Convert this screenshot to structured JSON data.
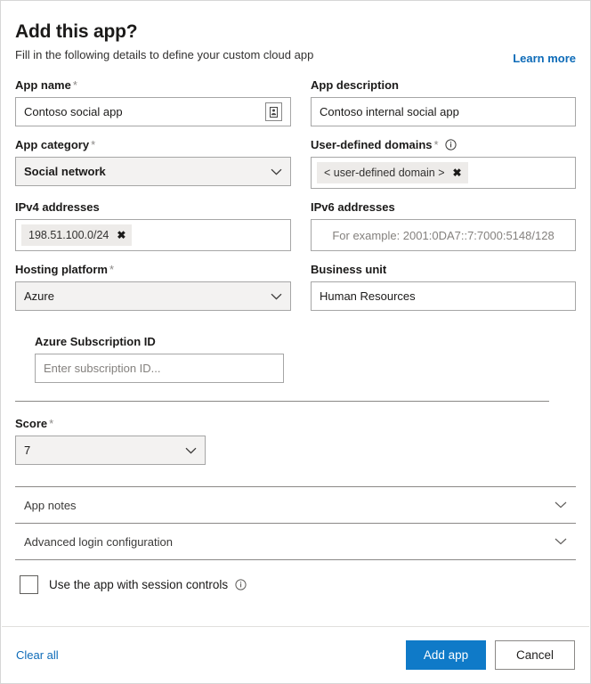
{
  "header": {
    "title": "Add this app?",
    "subtitle": "Fill in the following details to define your custom cloud app",
    "learn_more": "Learn more"
  },
  "form": {
    "app_name": {
      "label": "App name",
      "required": "*",
      "value": "Contoso social app",
      "inline_button_icon": "id-card-icon"
    },
    "app_description": {
      "label": "App description",
      "value": "Contoso internal social app"
    },
    "app_category": {
      "label": "App category",
      "required": "*",
      "value": "Social network",
      "options": [
        "Social network"
      ]
    },
    "user_defined_domains": {
      "label": "User-defined domains",
      "required": "*",
      "info_icon": "info-icon",
      "chips": [
        "< user-defined domain >"
      ],
      "chip_remove": "✖"
    },
    "ipv4_addresses": {
      "label": "IPv4 addresses",
      "chips": [
        "198.51.100.0/24"
      ],
      "chip_remove": "✖"
    },
    "ipv6_addresses": {
      "label": "IPv6 addresses",
      "placeholder": "For example: 2001:0DA7::7:7000:5148/128",
      "value": ""
    },
    "hosting_platform": {
      "label": "Hosting platform",
      "required": "*",
      "value": "Azure",
      "options": [
        "Azure"
      ]
    },
    "business_unit": {
      "label": "Business unit",
      "value": "Human Resources"
    },
    "azure_subscription_id": {
      "label": "Azure Subscription ID",
      "placeholder": "Enter subscription ID...",
      "value": ""
    },
    "score": {
      "label": "Score",
      "required": "*",
      "value": "7",
      "options": [
        "7"
      ]
    }
  },
  "accordions": [
    {
      "label": "App notes",
      "expanded": false,
      "icon": "chevron-down-icon"
    },
    {
      "label": "Advanced login configuration",
      "expanded": false,
      "icon": "chevron-down-icon"
    }
  ],
  "session_controls": {
    "label": "Use the app with session controls",
    "checked": false,
    "info_icon": "info-icon"
  },
  "footer": {
    "clear_all": "Clear all",
    "primary_button": "Add app",
    "secondary_button": "Cancel"
  },
  "colors": {
    "accent": "#0f7ac8",
    "link": "#0d6bb8",
    "field_border": "#a6a6a6",
    "chip_bg": "#edebe9",
    "select_bg": "#f3f2f1"
  }
}
